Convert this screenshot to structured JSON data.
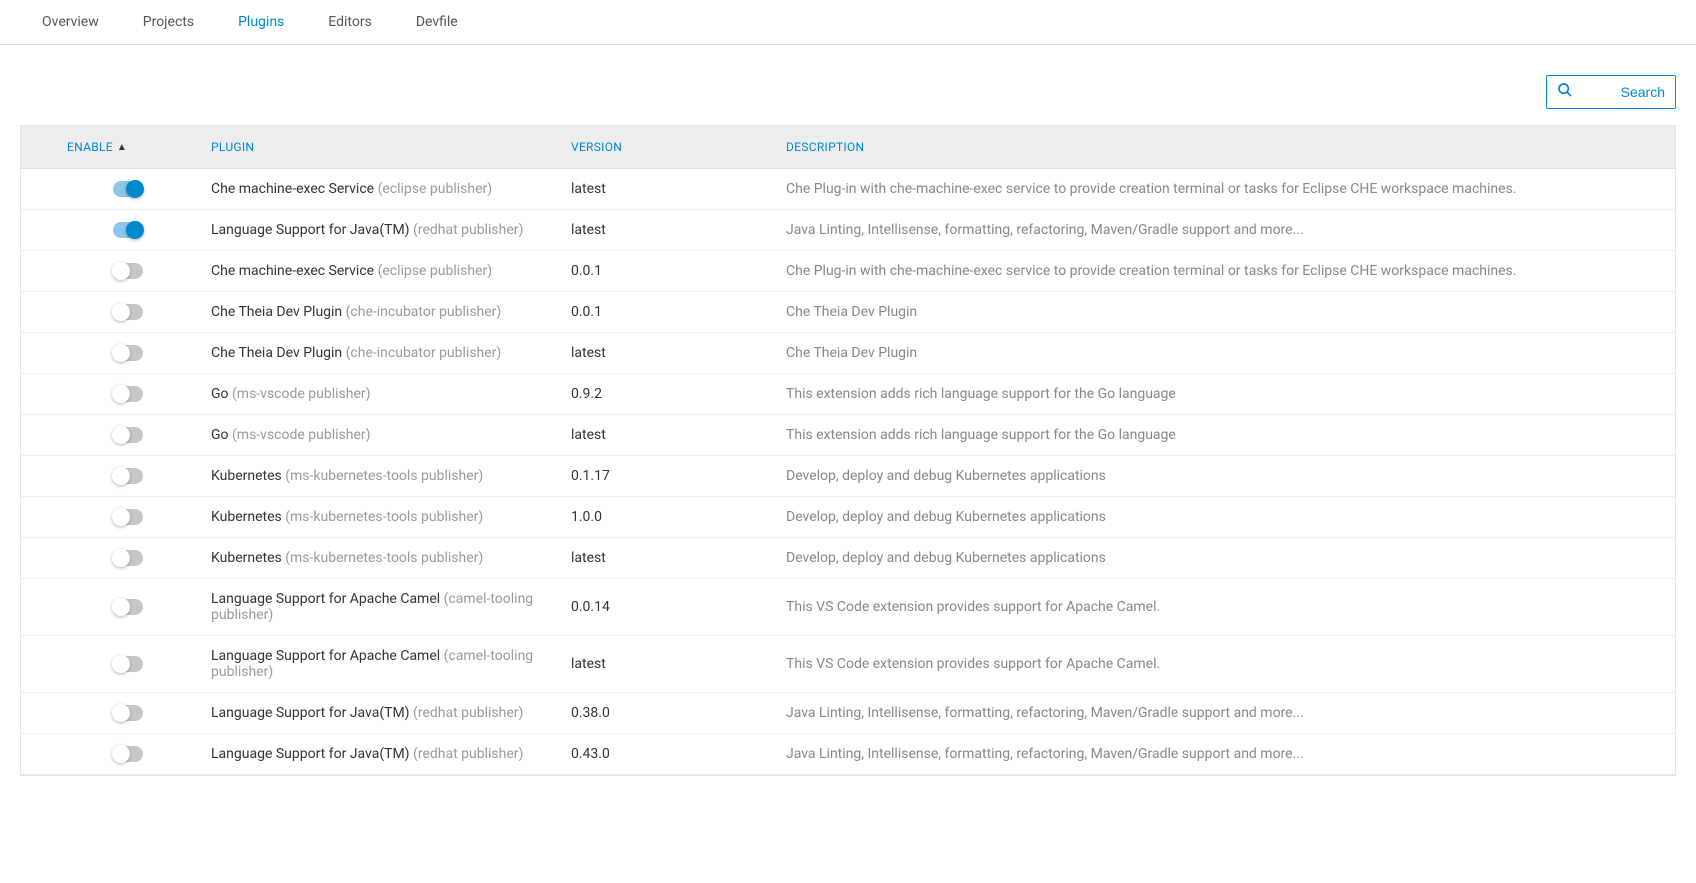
{
  "tabs": {
    "items": [
      {
        "label": "Overview",
        "active": false
      },
      {
        "label": "Projects",
        "active": false
      },
      {
        "label": "Plugins",
        "active": true
      },
      {
        "label": "Editors",
        "active": false
      },
      {
        "label": "Devfile",
        "active": false
      }
    ]
  },
  "search": {
    "placeholder": "Search"
  },
  "table": {
    "headers": {
      "enable": "ENABLE",
      "plugin": "PLUGIN",
      "version": "VERSION",
      "description": "DESCRIPTION"
    },
    "sort_indicator": "▲",
    "rows": [
      {
        "enabled": true,
        "name": "Che machine-exec Service",
        "publisher": "(eclipse publisher)",
        "version": "latest",
        "description": "Che Plug-in with che-machine-exec service to provide creation terminal or tasks for Eclipse CHE workspace machines."
      },
      {
        "enabled": true,
        "name": "Language Support for Java(TM)",
        "publisher": "(redhat publisher)",
        "version": "latest",
        "description": "Java Linting, Intellisense, formatting, refactoring, Maven/Gradle support and more..."
      },
      {
        "enabled": false,
        "name": "Che machine-exec Service",
        "publisher": "(eclipse publisher)",
        "version": "0.0.1",
        "description": "Che Plug-in with che-machine-exec service to provide creation terminal or tasks for Eclipse CHE workspace machines."
      },
      {
        "enabled": false,
        "name": "Che Theia Dev Plugin",
        "publisher": "(che-incubator publisher)",
        "version": "0.0.1",
        "description": "Che Theia Dev Plugin"
      },
      {
        "enabled": false,
        "name": "Che Theia Dev Plugin",
        "publisher": "(che-incubator publisher)",
        "version": "latest",
        "description": "Che Theia Dev Plugin"
      },
      {
        "enabled": false,
        "name": "Go",
        "publisher": "(ms-vscode publisher)",
        "version": "0.9.2",
        "description": "This extension adds rich language support for the Go language"
      },
      {
        "enabled": false,
        "name": "Go",
        "publisher": "(ms-vscode publisher)",
        "version": "latest",
        "description": "This extension adds rich language support for the Go language"
      },
      {
        "enabled": false,
        "name": "Kubernetes",
        "publisher": "(ms-kubernetes-tools publisher)",
        "version": "0.1.17",
        "description": "Develop, deploy and debug Kubernetes applications"
      },
      {
        "enabled": false,
        "name": "Kubernetes",
        "publisher": "(ms-kubernetes-tools publisher)",
        "version": "1.0.0",
        "description": "Develop, deploy and debug Kubernetes applications"
      },
      {
        "enabled": false,
        "name": "Kubernetes",
        "publisher": "(ms-kubernetes-tools publisher)",
        "version": "latest",
        "description": "Develop, deploy and debug Kubernetes applications"
      },
      {
        "enabled": false,
        "name": "Language Support for Apache Camel",
        "publisher": "(camel-tooling publisher)",
        "version": "0.0.14",
        "description": "This VS Code extension provides support for Apache Camel."
      },
      {
        "enabled": false,
        "name": "Language Support for Apache Camel",
        "publisher": "(camel-tooling publisher)",
        "version": "latest",
        "description": "This VS Code extension provides support for Apache Camel."
      },
      {
        "enabled": false,
        "name": "Language Support for Java(TM)",
        "publisher": "(redhat publisher)",
        "version": "0.38.0",
        "description": "Java Linting, Intellisense, formatting, refactoring, Maven/Gradle support and more..."
      },
      {
        "enabled": false,
        "name": "Language Support for Java(TM)",
        "publisher": "(redhat publisher)",
        "version": "0.43.0",
        "description": "Java Linting, Intellisense, formatting, refactoring, Maven/Gradle support and more..."
      }
    ]
  }
}
